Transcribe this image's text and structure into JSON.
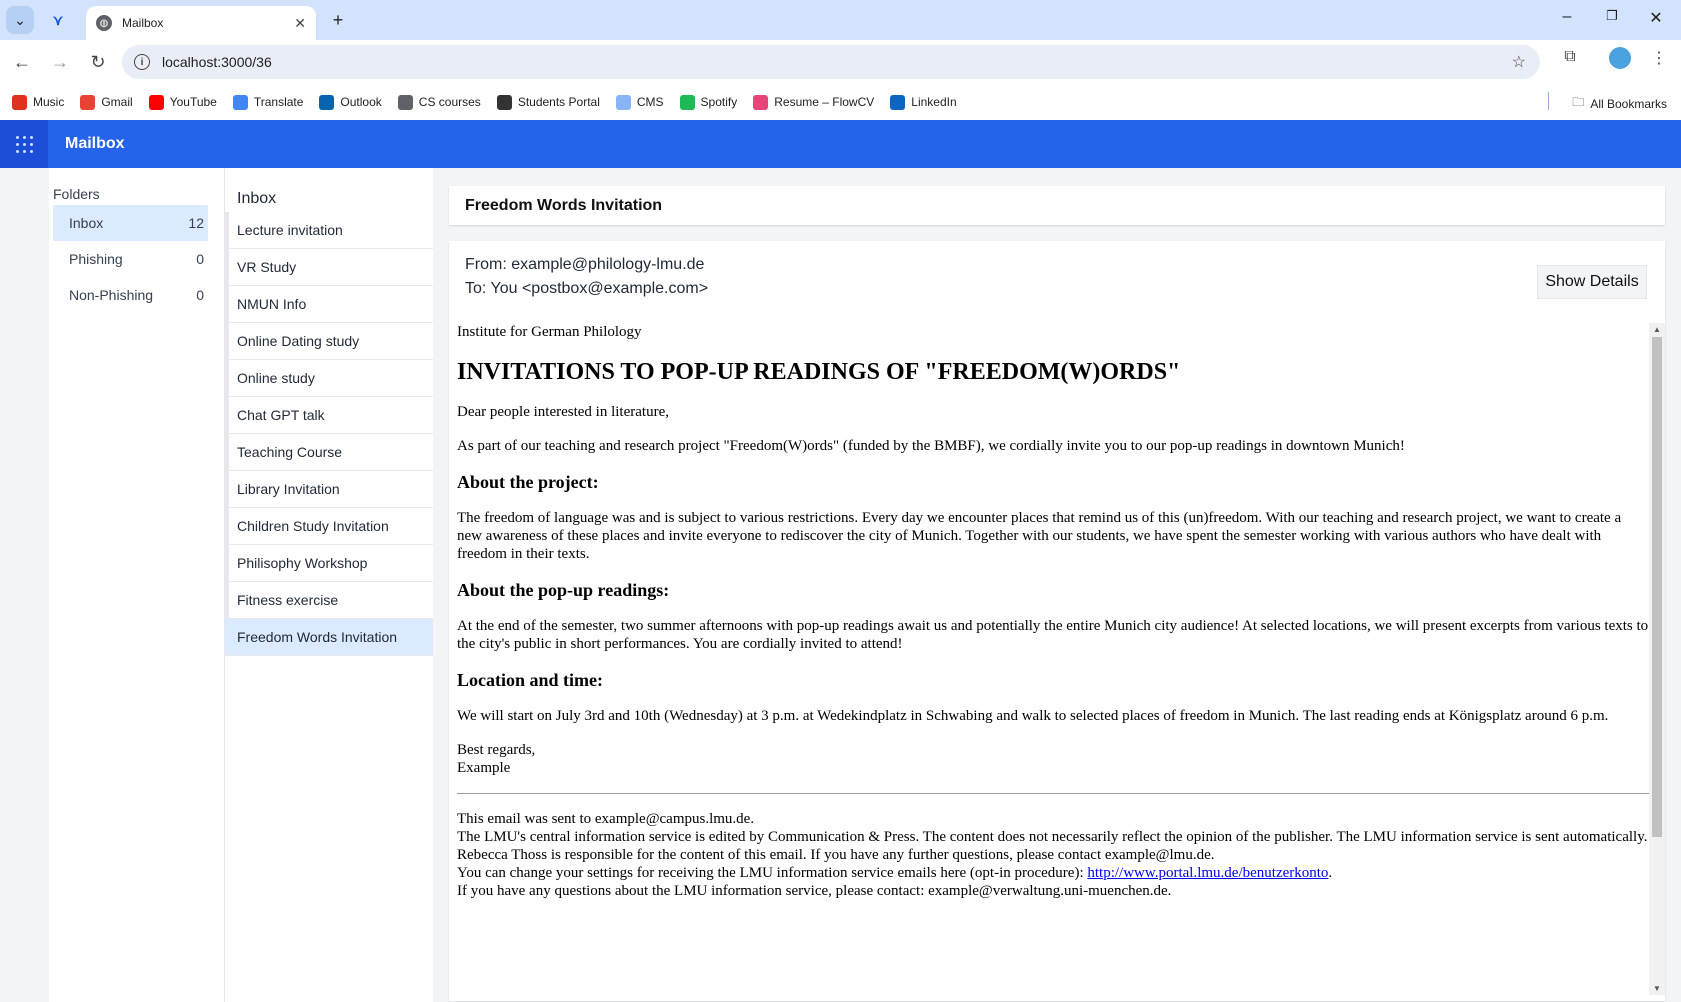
{
  "browser": {
    "tab_title": "Mailbox",
    "url": "localhost:3000/36",
    "bookmarks": [
      {
        "label": "Music",
        "color": "#e0301e"
      },
      {
        "label": "Gmail",
        "color": "#ea4335"
      },
      {
        "label": "YouTube",
        "color": "#ff0000"
      },
      {
        "label": "Translate",
        "color": "#4285f4"
      },
      {
        "label": "Outlook",
        "color": "#0a64ad"
      },
      {
        "label": "CS courses",
        "color": "#5f6368"
      },
      {
        "label": "Students Portal",
        "color": "#333333"
      },
      {
        "label": "CMS",
        "color": "#8ab4f8"
      },
      {
        "label": "Spotify",
        "color": "#1db954"
      },
      {
        "label": "Resume – FlowCV",
        "color": "#e6457a"
      },
      {
        "label": "LinkedIn",
        "color": "#0a66c2"
      }
    ],
    "all_bookmarks": "All Bookmarks"
  },
  "app": {
    "title": "Mailbox",
    "accent": "#2563eb"
  },
  "folders": {
    "title": "Folders",
    "items": [
      {
        "label": "Inbox",
        "count": "12"
      },
      {
        "label": "Phishing",
        "count": "0"
      },
      {
        "label": "Non-Phishing",
        "count": "0"
      }
    ]
  },
  "inbox": {
    "title": "Inbox",
    "items": [
      "Lecture invitation",
      "VR Study",
      "NMUN Info",
      "Online Dating study",
      "Online study",
      "Chat GPT talk",
      "Teaching Course",
      "Library Invitation",
      "Children Study Invitation",
      "Philisophy Workshop",
      "Fitness exercise",
      "Freedom Words Invitation"
    ]
  },
  "email": {
    "subject": "Freedom Words Invitation",
    "from": "From: example@philology-lmu.de",
    "to": "To: You <postbox@example.com>",
    "details_button": "Show Details",
    "body": {
      "institute": "Institute for German Philology",
      "heading": "INVITATIONS TO POP-UP READINGS OF \"FREEDOM(W)ORDS\"",
      "greeting": "Dear people interested in literature,",
      "intro": "As part of our teaching and research project \"Freedom(W)ords\" (funded by the BMBF), we cordially invite you to our pop-up readings in downtown Munich!",
      "h_project": "About the project:",
      "p_project": "The freedom of language was and is subject to various restrictions. Every day we encounter places that remind us of this (un)freedom. With our teaching and research project, we want to create a new awareness of these places and invite everyone to rediscover the city of Munich. Together with our students, we have spent the semester working with various authors who have dealt with freedom in their texts.",
      "h_readings": "About the pop-up readings:",
      "p_readings": "At the end of the semester, two summer afternoons with pop-up readings await us and potentially the entire Munich city audience! At selected locations, we will present excerpts from various texts to the city's public in short performances. You are cordially invited to attend!",
      "h_location": "Location and time:",
      "p_location": "We will start on July 3rd and 10th (Wednesday) at 3 p.m. at Wedekindplatz in Schwabing and walk to selected places of freedom in Munich. The last reading ends at Königsplatz around 6 p.m.",
      "regards": "Best regards,",
      "signature": "Example",
      "footer_1": "This email was sent to example@campus.lmu.de.",
      "footer_2": "The LMU's central information service is edited by Communication & Press. The content does not necessarily reflect the opinion of the publisher. The LMU information service is sent automatically.",
      "footer_3": "Rebecca Thoss is responsible for the content of this email. If you have any further questions, please contact example@lmu.de.",
      "footer_4": "You can change your settings for receiving the LMU information service emails here (opt-in procedure): ",
      "footer_link": "http://www.portal.lmu.de/benutzerkonto",
      "footer_4_end": ".",
      "footer_5": "If you have any questions about the LMU information service, please contact: example@verwaltung.uni-muenchen.de."
    }
  }
}
